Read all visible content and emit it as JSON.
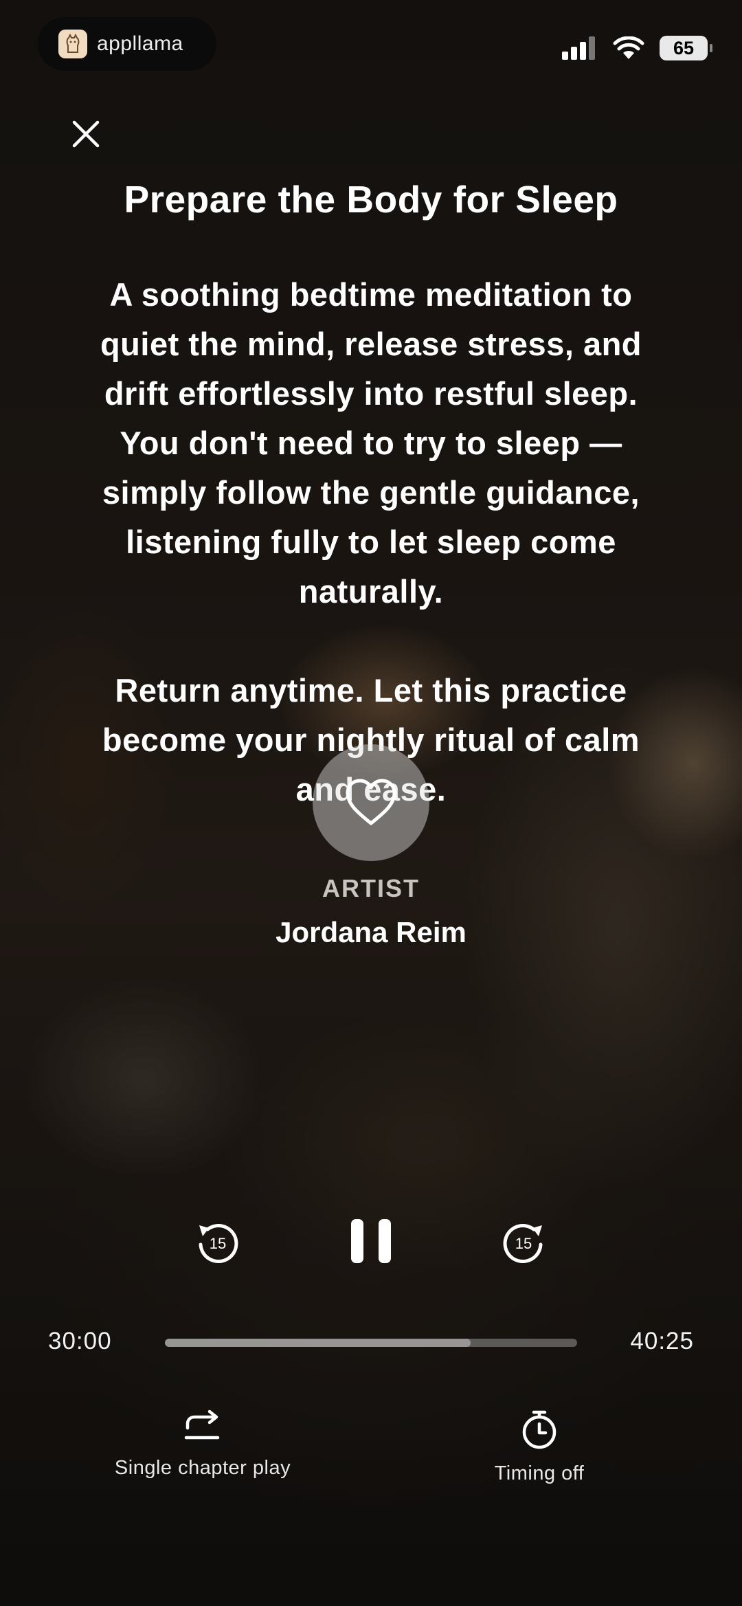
{
  "status_bar": {
    "app_name": "appllama",
    "battery": "65",
    "icons": [
      "signal-icon",
      "wifi-icon",
      "battery-icon"
    ]
  },
  "player": {
    "title": "Prepare the Body for Sleep",
    "description": "A soothing bedtime meditation to\nquiet the mind, release stress, and\ndrift effortlessly into restful sleep.\nYou don't need to try to sleep —\nsimply follow the gentle guidance,\nlistening fully to let sleep come\nnaturally.\n\nReturn anytime. Let this practice\nbecome your nightly ritual of calm\nand ease.",
    "artist_label": "ARTIST",
    "artist_name": "Jordana Reim",
    "skip_back_seconds": "15",
    "skip_forward_seconds": "15",
    "current_time": "30:00",
    "total_time": "40:25",
    "progress_fraction": 0.742
  },
  "options": {
    "repeat_label": "Single chapter play",
    "timer_label": "Timing off"
  }
}
